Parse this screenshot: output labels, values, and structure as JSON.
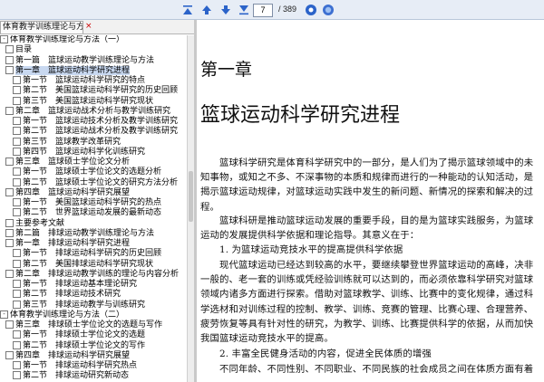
{
  "toolbar": {
    "page_current": "7",
    "page_total": "/ 389",
    "icons": [
      "first-page-icon",
      "prev-page-icon",
      "next-page-icon",
      "last-page-icon",
      "go-icon",
      "settings-icon"
    ]
  },
  "sidebar": {
    "tab_label": "体育教学训练理论与方法(...",
    "tab_close": "×",
    "tree": [
      {
        "label": "体育教学训练理论与方法（一）",
        "level": 0,
        "expander": "-"
      },
      {
        "label": "目录",
        "level": 1
      },
      {
        "label": "第一篇　篮球运动教学训练理论与方法",
        "level": 1
      },
      {
        "label": "第一章　篮球运动科学研究进程",
        "level": 1,
        "selected": true
      },
      {
        "label": "第一节　篮球运动科学研究的特点",
        "level": 2
      },
      {
        "label": "第二节　美国篮球运动科学研究的历史回顾",
        "level": 2
      },
      {
        "label": "第三节　美国篮球运动科学研究现状",
        "level": 2
      },
      {
        "label": "第二章　篮球运动战术分析与教学训练研究",
        "level": 1
      },
      {
        "label": "第一节　篮球运动技术分析及教学训练研究",
        "level": 2
      },
      {
        "label": "第二节　篮球运动战术分析及教学训练研究",
        "level": 2
      },
      {
        "label": "第三节　篮球教学改革研究",
        "level": 2
      },
      {
        "label": "第四节　篮球运动科学化训练研究",
        "level": 2
      },
      {
        "label": "第三章　篮球硕士学位论文分析",
        "level": 1
      },
      {
        "label": "第一节　篮球硕士学位论文的选题分析",
        "level": 2
      },
      {
        "label": "第二节　篮球硕士学位论文的研究方法分析",
        "level": 2
      },
      {
        "label": "第四章　篮球运动科学研究展望",
        "level": 1
      },
      {
        "label": "第一节　美国篮球运动科学研究的热点",
        "level": 2
      },
      {
        "label": "第二节　世界篮球运动发展的最新动态",
        "level": 2
      },
      {
        "label": "主要参考文献",
        "level": 1
      },
      {
        "label": "第二篇　排球运动教学训练理论与方法",
        "level": 1
      },
      {
        "label": "第一章　排球运动科学研究进程",
        "level": 1
      },
      {
        "label": "第一节　排球运动科学研究的历史回顾",
        "level": 2
      },
      {
        "label": "第二节　美国排球运动科学研究现状",
        "level": 2
      },
      {
        "label": "第二章　排球运动教学训练的理论与内容分析",
        "level": 1
      },
      {
        "label": "第一节　排球运动基本理论研究",
        "level": 2
      },
      {
        "label": "第二节　排球运动技术研究",
        "level": 2
      },
      {
        "label": "第三节　排球运动教学与训练研究",
        "level": 2
      },
      {
        "label": "体育教学训练理论与方法（二）",
        "level": 0,
        "expander": "-"
      },
      {
        "label": "第三章　排球硕士学位论文的选题与写作",
        "level": 1
      },
      {
        "label": "第一节　排球硕士学位论文的选题",
        "level": 2
      },
      {
        "label": "第二节　排球硕士学位论文的写作",
        "level": 2
      },
      {
        "label": "第四章　排球运动科学研究展望",
        "level": 1
      },
      {
        "label": "第一节　排球运动科学研究热点",
        "level": 2
      },
      {
        "label": "第二节　排球运动研究新动态",
        "level": 2
      }
    ]
  },
  "document": {
    "chapter_number": "第一章",
    "chapter_title": "篮球运动科学研究进程",
    "paragraphs": [
      "篮球科学研究是体育科学研究中的一部分，是人们为了揭示篮球领域中的未知事物，或知之不多、不深事物的本质和规律而进行的一种能动的认知活动，是揭示篮球运动规律，对篮球运动实践中发生的新问题、新情况的探索和解决的过程。",
      "篮球科研是推动篮球运动发展的重要手段，目的是为篮球实践服务，为篮球运动的发展提供科学依据和理论指导。其意义在于：",
      "1. 为篮球运动竞技水平的提高提供科学依据",
      "现代篮球运动已经达到较高的水平，要继续攀登世界篮球运动的高峰，决非一般的、老一套的训练或凭经验训练就可以达到的，而必须依靠科学研究对篮球领域内诸多方面进行探索。借助对篮球教学、训练、比赛中的变化规律，通过科学选材和对训练过程的控制、教学、训练、竞赛的管理、比赛心理、合理营养、疲劳恢复等具有针对性的研究，为教学、训练、比赛提供科学的依据，从而加快我国篮球运动竞技水平的提高。",
      "2. 丰富全民健身活动的内容，促进全民体质的增强",
      "不同年龄、不同性别、不同职业、不同民族的社会成员之间在体质方面有着"
    ]
  }
}
